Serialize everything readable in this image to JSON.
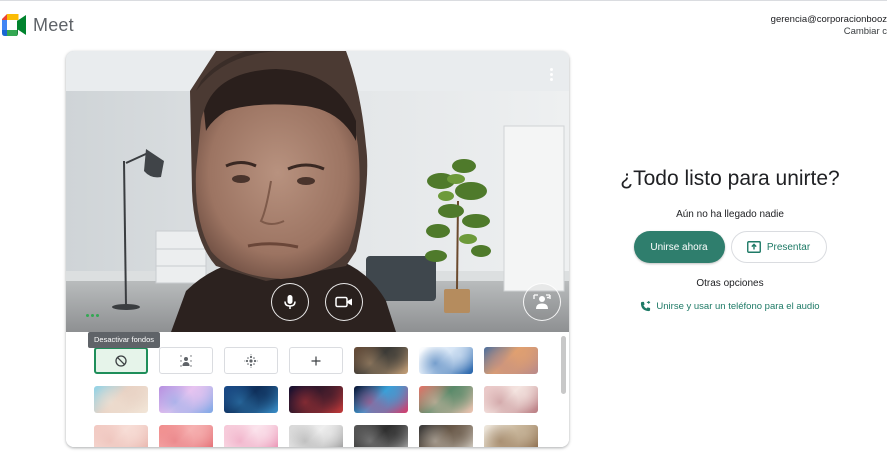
{
  "app": {
    "name": "Meet"
  },
  "account": {
    "email": "gerencia@corporacionbooz",
    "switch_label": "Cambiar c"
  },
  "tooltip": {
    "text": "Desactivar fondos"
  },
  "join": {
    "title": "¿Todo listo para unirte?",
    "status": "Aún no ha llegado nadie",
    "join_label": "Unirse ahora",
    "present_label": "Presentar",
    "other_options": "Otras opciones",
    "phone_label": "Unirse y usar un teléfono para el audio"
  },
  "colors": {
    "accent": "#2f7e6d",
    "link": "#1e7a66",
    "selected": "#1e8e5a"
  },
  "backgrounds": [
    {
      "name": "bg-off",
      "kind": "icon",
      "icon": "no-background-icon",
      "selected": true
    },
    {
      "name": "bg-slight-blur",
      "kind": "icon",
      "icon": "slight-blur-icon"
    },
    {
      "name": "bg-blur",
      "kind": "icon",
      "icon": "blur-icon"
    },
    {
      "name": "bg-add",
      "kind": "icon",
      "icon": "add-icon"
    },
    {
      "name": "bg-classroom",
      "kind": "image",
      "colors": [
        "#6b4f3a",
        "#c7a27a",
        "#3b3a36"
      ]
    },
    {
      "name": "bg-logo",
      "kind": "image",
      "colors": [
        "#ffffff",
        "#1f5fa8",
        "#d5e4f5"
      ]
    },
    {
      "name": "bg-sunset",
      "kind": "image",
      "colors": [
        "#4b6e9e",
        "#b98a8a",
        "#e0a070"
      ]
    },
    {
      "name": "bg-beach",
      "kind": "image",
      "colors": [
        "#8fd3e8",
        "#f2e6d8",
        "#e8d2c4"
      ]
    },
    {
      "name": "bg-clouds",
      "kind": "image",
      "colors": [
        "#b38fe0",
        "#7fa8e6",
        "#e7c4f0"
      ]
    },
    {
      "name": "bg-water",
      "kind": "image",
      "colors": [
        "#1b4d8c",
        "#3a8fc9",
        "#0e2f5a"
      ]
    },
    {
      "name": "bg-nebula",
      "kind": "image",
      "colors": [
        "#1a1030",
        "#c43a3a",
        "#3a1a2a"
      ]
    },
    {
      "name": "bg-fireworks",
      "kind": "image",
      "colors": [
        "#0b1030",
        "#d83a6a",
        "#3aa0d8"
      ]
    },
    {
      "name": "bg-flowers",
      "kind": "image",
      "colors": [
        "#e8756a",
        "#f2c6b4",
        "#5a8a6a"
      ]
    },
    {
      "name": "bg-blossoms",
      "kind": "image",
      "colors": [
        "#e8c4c4",
        "#b87a80",
        "#f4e4e0"
      ]
    },
    {
      "name": "bg-pink-texture",
      "kind": "image",
      "colors": [
        "#f1c7c0",
        "#e8b4ac",
        "#f7ddd6"
      ]
    },
    {
      "name": "bg-pink-pattern",
      "kind": "image",
      "colors": [
        "#f08a8a",
        "#e36b72",
        "#f6b1b1"
      ]
    },
    {
      "name": "bg-pink-petals",
      "kind": "image",
      "colors": [
        "#f6c6d6",
        "#e98fb1",
        "#fbe3ec"
      ]
    },
    {
      "name": "bg-office",
      "kind": "image",
      "colors": [
        "#d6d6d6",
        "#9a9a9a",
        "#eeeeee"
      ]
    },
    {
      "name": "bg-loft",
      "kind": "image",
      "colors": [
        "#5a5a5a",
        "#a8a8a8",
        "#2e2e2e"
      ]
    },
    {
      "name": "bg-room",
      "kind": "image",
      "colors": [
        "#3a3a3a",
        "#d8d2c8",
        "#6a5a4a"
      ]
    },
    {
      "name": "bg-shelves",
      "kind": "image",
      "colors": [
        "#efe9e0",
        "#8a6a4a",
        "#c9b79c"
      ]
    }
  ]
}
